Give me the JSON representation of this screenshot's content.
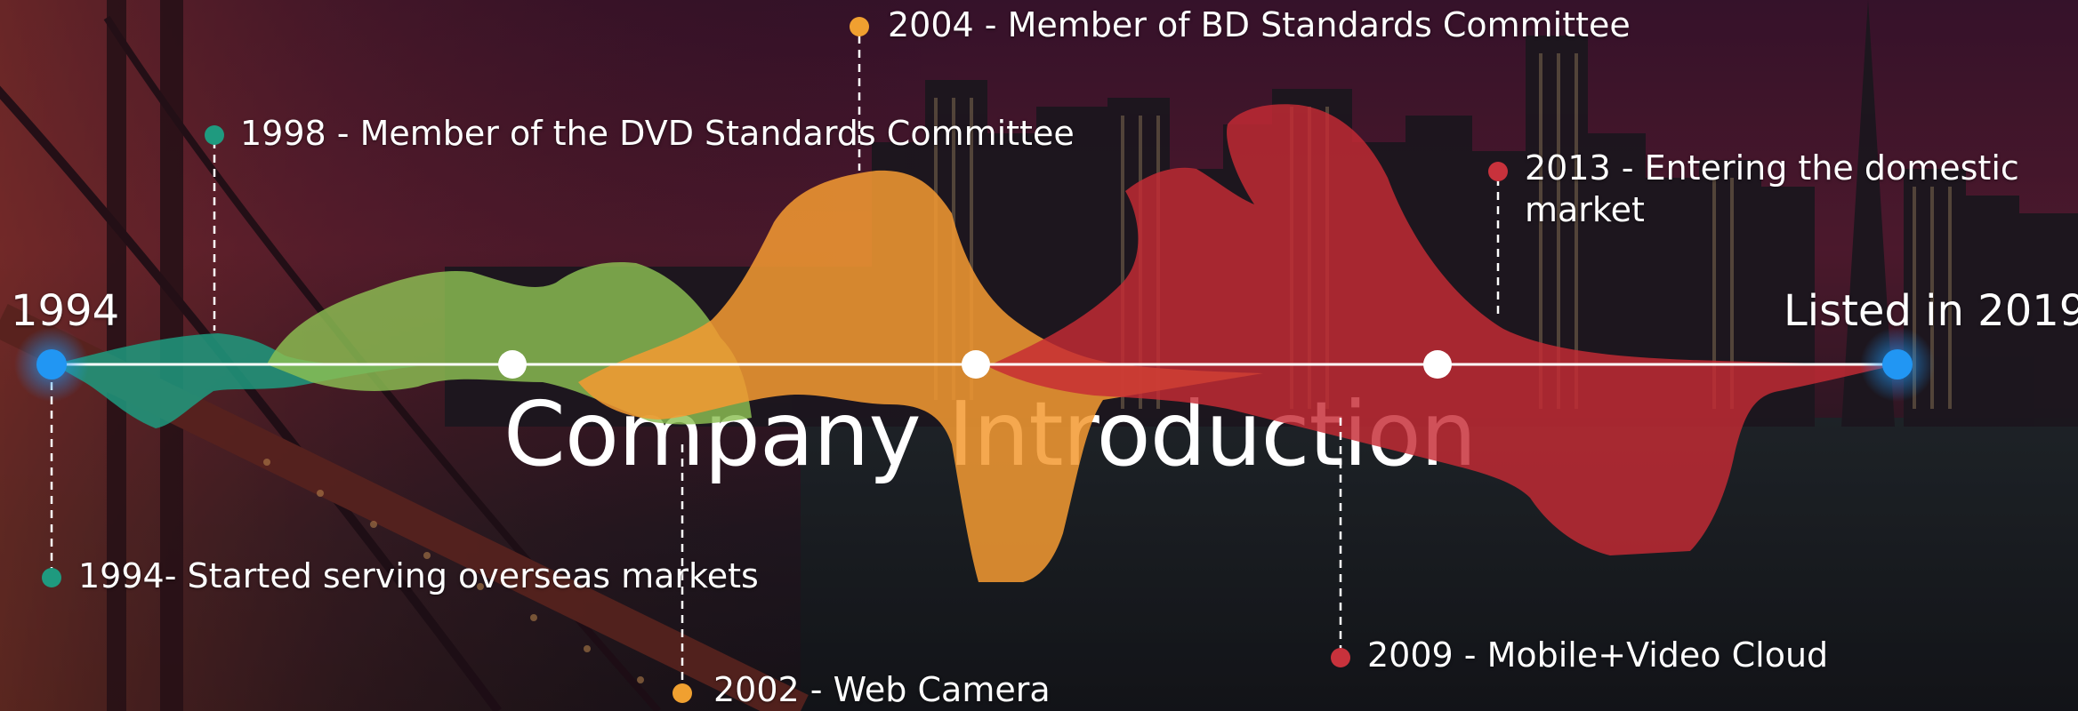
{
  "slide": {
    "title": "Company Introduction",
    "start_label": "1994",
    "end_label": "Listed in 2019"
  },
  "events": [
    {
      "id": "e1994",
      "text": "1994- Started serving overseas markets",
      "color": "#1f9a7f"
    },
    {
      "id": "e1998",
      "text": "1998  - Member of the DVD Standards Committee",
      "color": "#1f9a7f"
    },
    {
      "id": "e2002",
      "text": "2002 - Web Camera",
      "color": "#f0a030"
    },
    {
      "id": "e2004",
      "text": "2004 -  Member of BD Standards Committee",
      "color": "#f0a030"
    },
    {
      "id": "e2009",
      "text": "2009 - Mobile+Video Cloud",
      "color": "#c8323c"
    },
    {
      "id": "e2013",
      "text": "2013 - Entering the domestic market",
      "color": "#c8323c"
    }
  ],
  "colors": {
    "teal": "#1f9a7f",
    "green": "#8cc053",
    "orange": "#f39a32",
    "red": "#c62b34",
    "node_blue": "#2196f3",
    "node_white": "#ffffff",
    "timeline": "#ffffff"
  },
  "icons": {
    "start_node": "circle-blue-glow",
    "end_node": "circle-blue-glow",
    "mid_nodes": "circle-white",
    "event_marker": "circle-dot"
  }
}
